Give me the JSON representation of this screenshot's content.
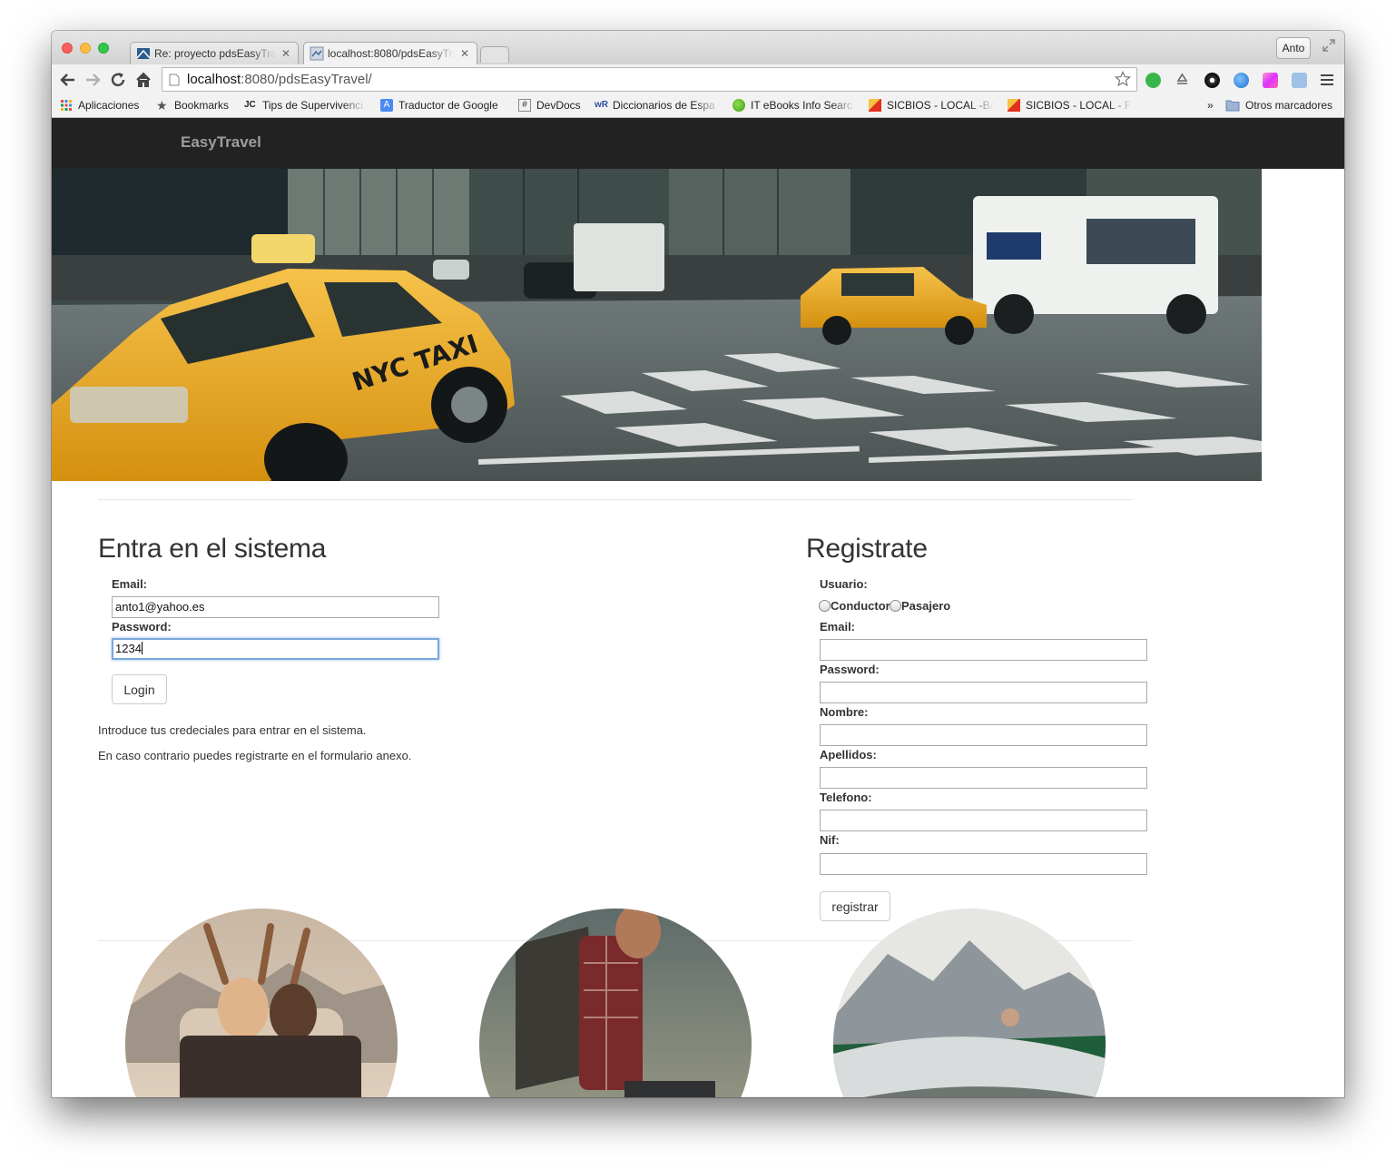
{
  "browser": {
    "tabs": [
      {
        "title": "Re: proyecto pdsEasyTrave"
      },
      {
        "title": "localhost:8080/pdsEasyTra"
      }
    ],
    "user_button": "Anto",
    "url_host": "localhost",
    "url_path": ":8080/pdsEasyTravel/",
    "bookmarks": [
      {
        "label": "Aplicaciones",
        "icon": "apps-grid-icon"
      },
      {
        "label": "Bookmarks",
        "icon": "star-icon"
      },
      {
        "label": "Tips de Supervivenci",
        "icon": "jc-icon"
      },
      {
        "label": "Traductor de Google",
        "icon": "translate-icon"
      },
      {
        "label": "DevDocs",
        "icon": "hash-icon"
      },
      {
        "label": "Diccionarios de Espa",
        "icon": "wr-icon"
      },
      {
        "label": "IT eBooks Info Searc",
        "icon": "ebook-icon"
      },
      {
        "label": "SICBIOS - LOCAL -BA",
        "icon": "sicbios-icon"
      },
      {
        "label": "SICBIOS - LOCAL - F",
        "icon": "sicbios-icon"
      }
    ],
    "bookmarks_overflow": "»",
    "other_bookmarks": "Otros marcadores"
  },
  "site": {
    "brand": "EasyTravel"
  },
  "login": {
    "title": "Entra en el sistema",
    "email_label": "Email:",
    "email_value": "anto1@yahoo.es",
    "password_label": "Password:",
    "password_value": "1234",
    "button": "Login",
    "help1": "Introduce tus credeciales para entrar en el sistema.",
    "help2": "En caso contrario puedes registrarte en el formulario anexo."
  },
  "register": {
    "title": "Registrate",
    "user_label": "Usuario:",
    "option_driver": "Conductor",
    "option_passenger": "Pasajero",
    "email_label": "Email:",
    "password_label": "Password:",
    "name_label": "Nombre:",
    "surname_label": "Apellidos:",
    "phone_label": "Telefono:",
    "nif_label": "Nif:",
    "button": "registrar"
  },
  "colors": {
    "navbar": "#222222",
    "brand": "#9d9d9d",
    "taxi": "#f2b21c"
  }
}
